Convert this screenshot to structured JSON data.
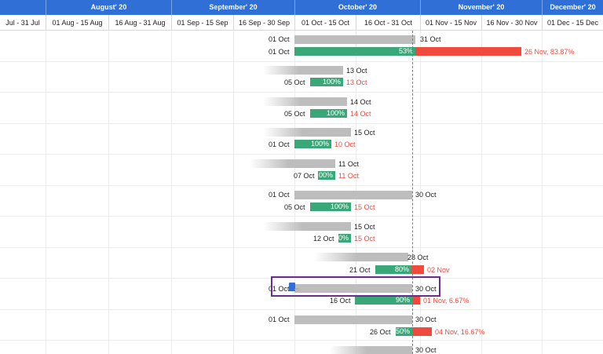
{
  "timeline": {
    "months": [
      "August' 20",
      "September' 20",
      "October' 20",
      "November' 20",
      "December' 20"
    ],
    "periods": [
      "Jul - 31 Jul",
      "01 Aug - 15 Aug",
      "16 Aug - 31 Aug",
      "01 Sep - 15 Sep",
      "16 Sep - 30 Sep",
      "01 Oct - 15 Oct",
      "16 Oct - 31 Oct",
      "01 Nov - 15 Nov",
      "16 Nov - 30 Nov",
      "01 Dec - 15 Dec"
    ]
  },
  "tasks": [
    {
      "plan_start": "01 Oct",
      "plan_end": "31 Oct",
      "actual_start": "01 Oct",
      "progress": "53%",
      "overdue": "26 Nov, 83.87%"
    },
    {
      "plan_start": "",
      "plan_end": "13 Oct",
      "actual_start": "05 Oct",
      "progress": "100%",
      "overdue": "13 Oct"
    },
    {
      "plan_start": "",
      "plan_end": "14 Oct",
      "actual_start": "05 Oct",
      "progress": "100%",
      "overdue": "14 Oct"
    },
    {
      "plan_start": "",
      "plan_end": "15 Oct",
      "actual_start": "01 Oct",
      "progress": "100%",
      "overdue": "10 Oct"
    },
    {
      "plan_start": "",
      "plan_end": "11 Oct",
      "actual_start": "07 Oct",
      "progress": "00%",
      "overdue": "11 Oct"
    },
    {
      "plan_start": "01 Oct",
      "plan_end": "30 Oct",
      "actual_start": "05 Oct",
      "progress": "100%",
      "overdue": "15 Oct"
    },
    {
      "plan_start": "",
      "plan_end": "15 Oct",
      "actual_start": "12 Oct",
      "progress": "0%",
      "overdue": "15 Oct"
    },
    {
      "plan_start": "",
      "plan_end": "28 Oct",
      "actual_start": "21 Oct",
      "progress": "80%",
      "overdue": "02 Nov"
    },
    {
      "plan_start": "01 Oct",
      "plan_end": "30 Oct",
      "actual_start": "16 Oct",
      "progress": "90%",
      "overdue": "01 Nov, 6.67%"
    },
    {
      "plan_start": "01 Oct",
      "plan_end": "30 Oct",
      "actual_start": "26 Oct",
      "progress": "50%",
      "overdue": "04 Nov, 16.67%"
    },
    {
      "plan_start": "",
      "plan_end": "30 Oct",
      "actual_start": "",
      "progress": "",
      "overdue": ""
    }
  ],
  "colors": {
    "header": "#2f6fd6",
    "planned": "#bdbdbd",
    "actual": "#3aa778",
    "overdue": "#f04a3e",
    "today": "#3a86ff",
    "selection": "#6a2c91"
  },
  "icons": {
    "drag_handle": "drag-handle-icon",
    "cursor": "move-cursor-icon"
  }
}
